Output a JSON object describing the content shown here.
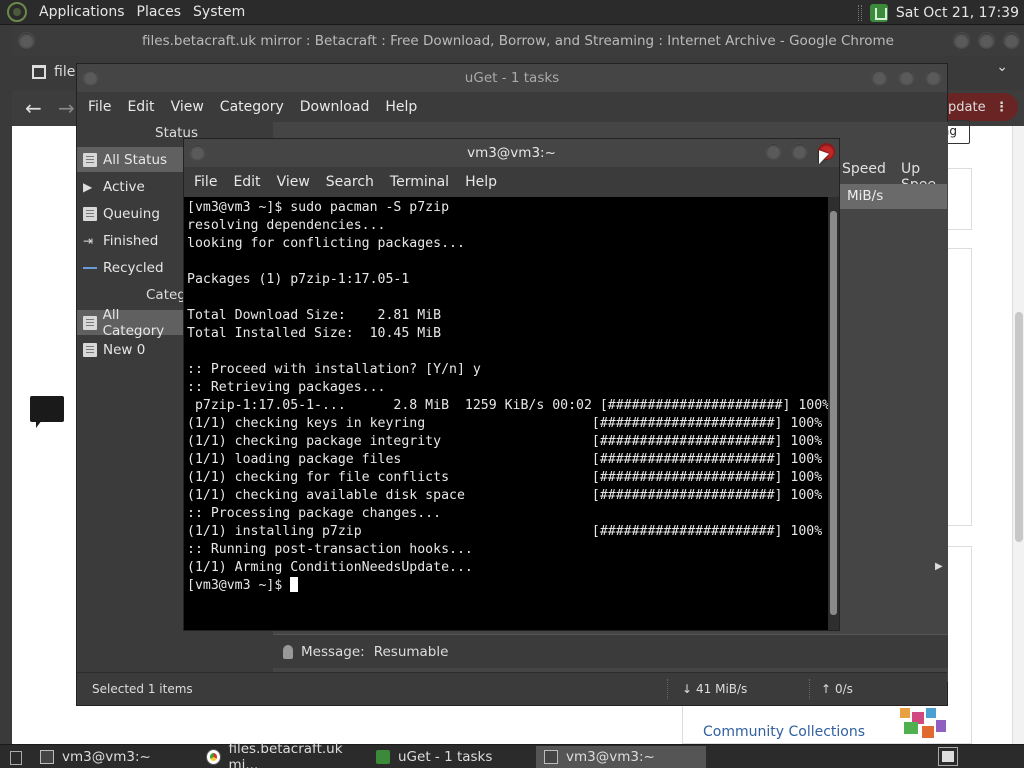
{
  "top_panel": {
    "menus": [
      "Applications",
      "Places",
      "System"
    ],
    "clock": "Sat Oct 21, 17:39"
  },
  "chrome": {
    "title": "files.betacraft.uk mirror : Betacraft : Free Download, Borrow, and Streaming : Internet Archive - Google Chrome",
    "tab_label": "file",
    "update_label": "pdate",
    "flag_label": "ag",
    "community_label": "Community Collections"
  },
  "uget": {
    "title": "uGet - 1 tasks",
    "menu": [
      "File",
      "Edit",
      "View",
      "Category",
      "Download",
      "Help"
    ],
    "status_header": "Status",
    "status_items": [
      "All Status",
      "Active",
      "Queuing",
      "Finished",
      "Recycled"
    ],
    "category_header": "Categ",
    "category_items": [
      "All Category",
      "New 0"
    ],
    "columns": [
      "Speed",
      "Up Spee"
    ],
    "row_speed": "MiB/s",
    "message_label": "Message:",
    "message_value": "Resumable",
    "selected_items": "Selected 1 items",
    "down_speed": "41 MiB/s",
    "up_speed": "0/s"
  },
  "terminal": {
    "title": "vm3@vm3:~",
    "menu": [
      "File",
      "Edit",
      "View",
      "Search",
      "Terminal",
      "Help"
    ],
    "lines": [
      "[vm3@vm3 ~]$ sudo pacman -S p7zip",
      "resolving dependencies...",
      "looking for conflicting packages...",
      "",
      "Packages (1) p7zip-1:17.05-1",
      "",
      "Total Download Size:    2.81 MiB",
      "Total Installed Size:  10.45 MiB",
      "",
      ":: Proceed with installation? [Y/n] y",
      ":: Retrieving packages...",
      " p7zip-1:17.05-1-...      2.8 MiB  1259 KiB/s 00:02 [######################] 100%",
      "(1/1) checking keys in keyring                     [######################] 100%",
      "(1/1) checking package integrity                   [######################] 100%",
      "(1/1) loading package files                        [######################] 100%",
      "(1/1) checking for file conflicts                  [######################] 100%",
      "(1/1) checking available disk space                [######################] 100%",
      ":: Processing package changes...",
      "(1/1) installing p7zip                             [######################] 100%",
      ":: Running post-transaction hooks...",
      "(1/1) Arming ConditionNeedsUpdate...",
      "[vm3@vm3 ~]$ "
    ]
  },
  "taskbar": {
    "items": [
      "vm3@vm3:~",
      "files.betacraft.uk mi...",
      "uGet - 1 tasks",
      "vm3@vm3:~"
    ]
  }
}
